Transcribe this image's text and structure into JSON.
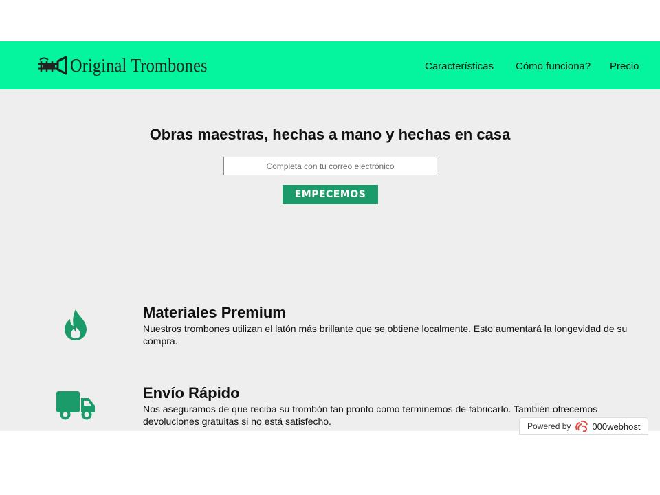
{
  "header": {
    "brand": "Original Trombones",
    "nav": [
      {
        "label": "Características"
      },
      {
        "label": "Cómo funciona?"
      },
      {
        "label": "Precio"
      }
    ]
  },
  "hero": {
    "title": "Obras maestras, hechas a mano y hechas en casa",
    "email_placeholder": "Completa con tu correo electrónico",
    "cta_label": "EMPECEMOS"
  },
  "features": [
    {
      "icon": "fire-icon",
      "title": "Materiales Premium",
      "description": "Nuestros trombones utilizan el latón más brillante que se obtiene localmente. Esto aumentará la longevidad de su compra."
    },
    {
      "icon": "truck-icon",
      "title": "Envío Rápido",
      "description": "Nos aseguramos de que reciba su trombón tan pronto como terminemos de fabricarlo. También ofrecemos devoluciones gratuitas si no está satisfecho."
    }
  ],
  "badge": {
    "powered_label": "Powered by",
    "provider": "000webhost"
  },
  "colors": {
    "header_bg": "#04f59d",
    "accent": "#1b9b6a",
    "main_bg": "#eeeeee"
  }
}
